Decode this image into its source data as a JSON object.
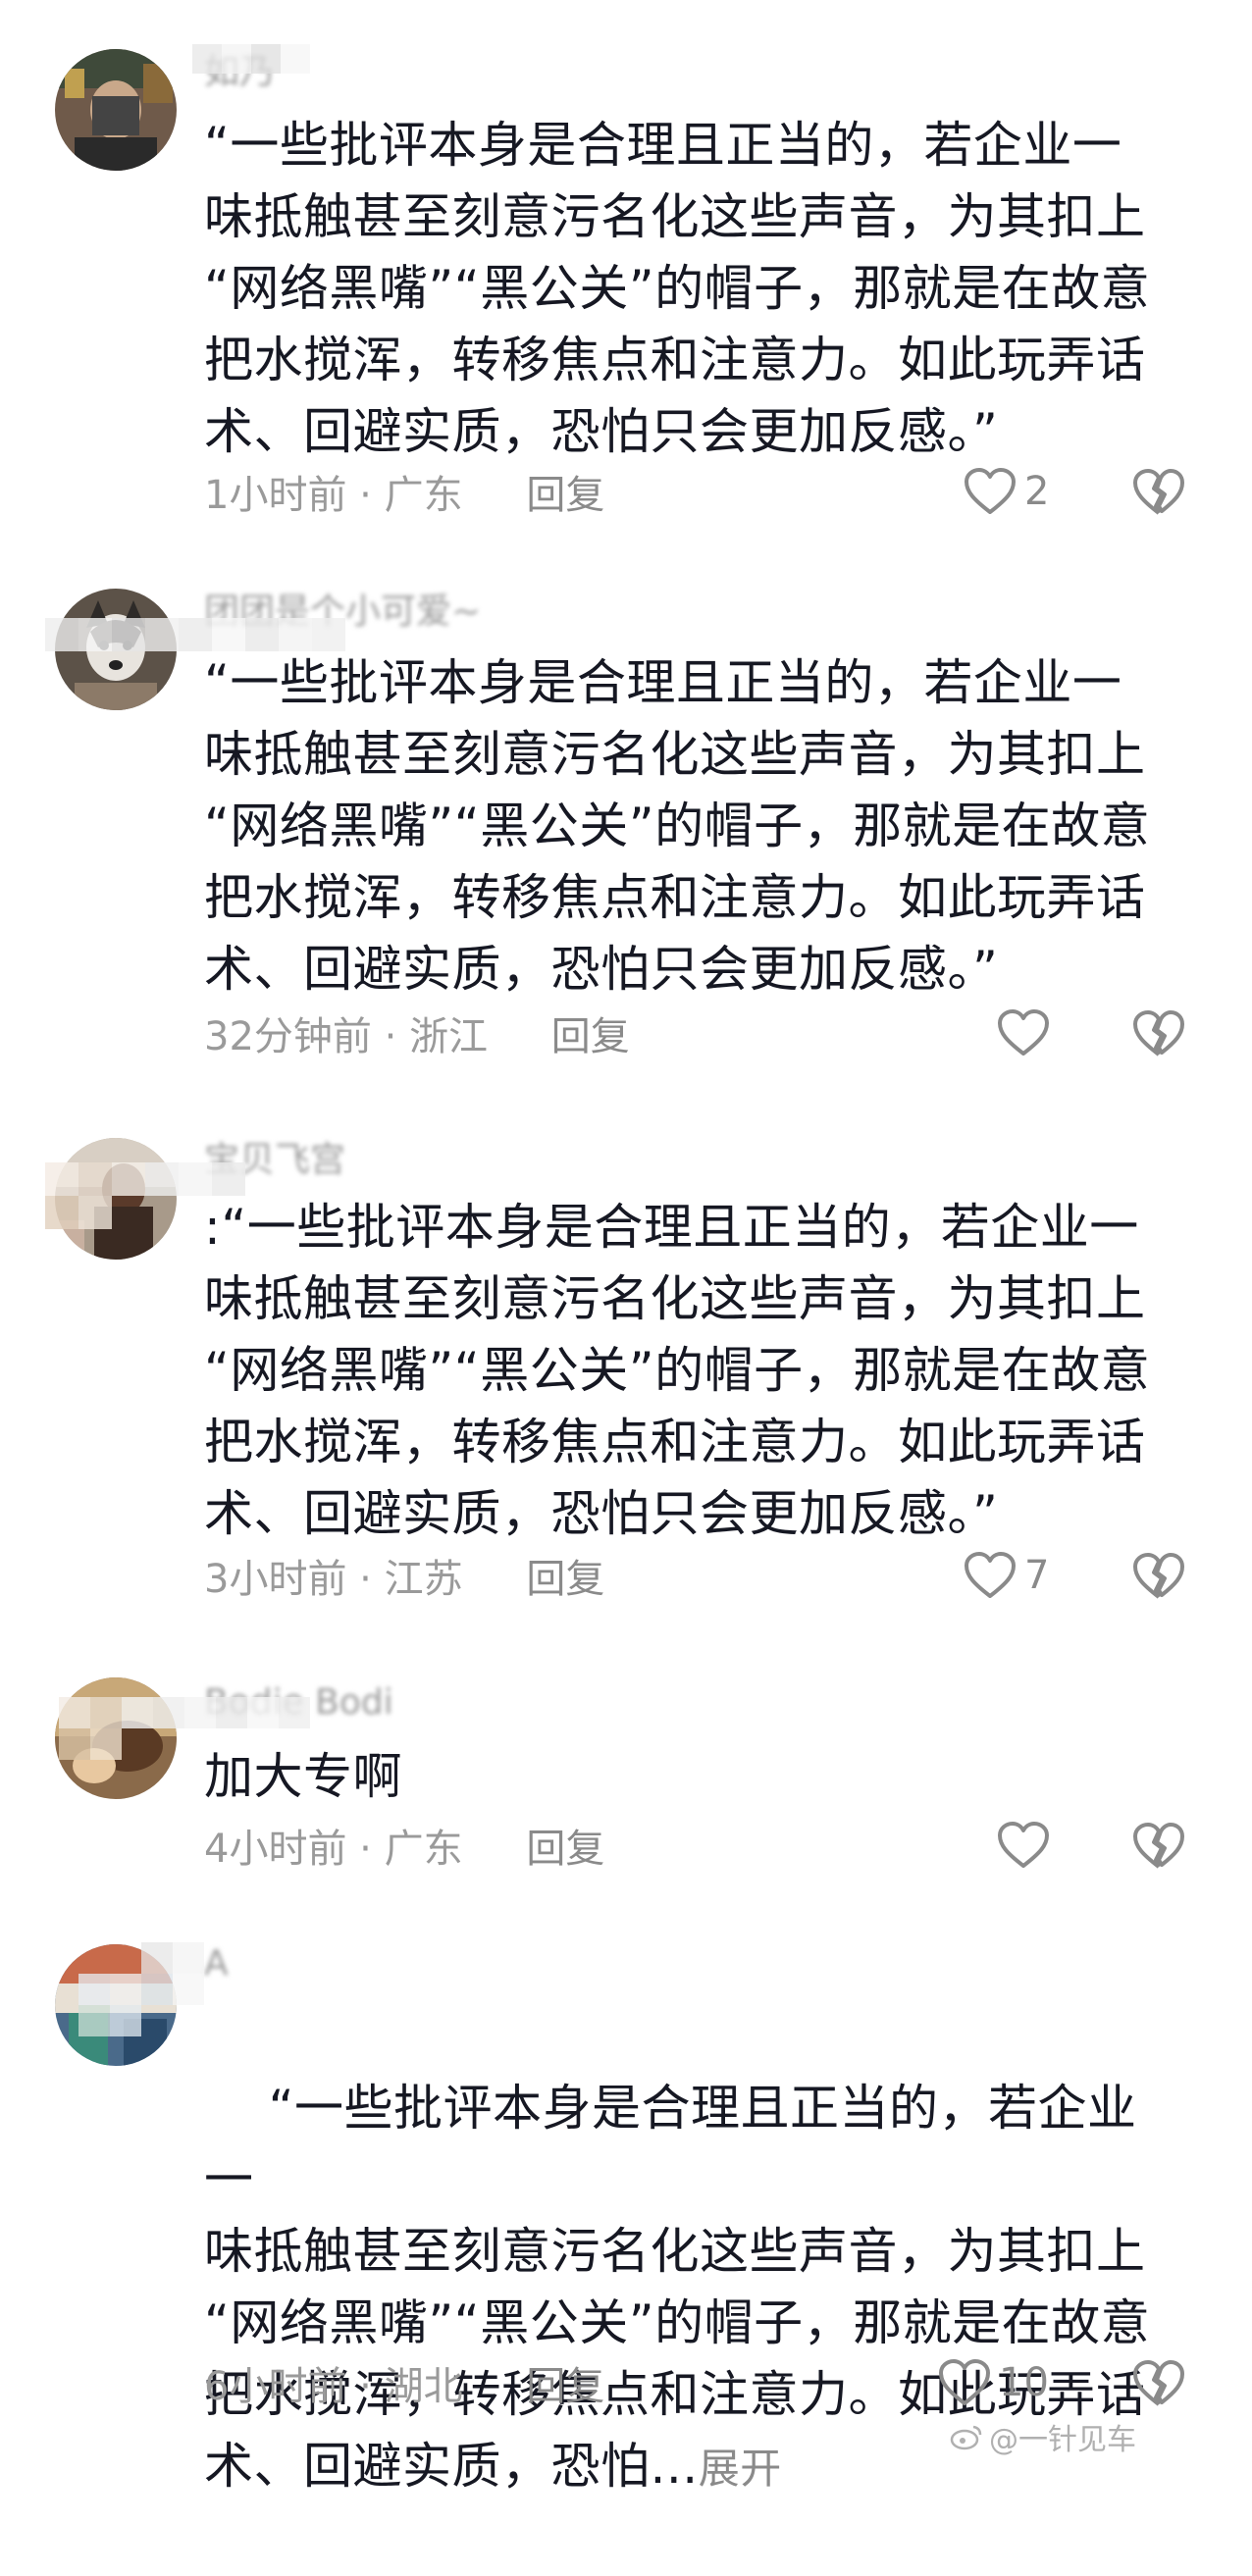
{
  "colors": {
    "text": "#161823",
    "meta": "#9a9a9a",
    "icon": "#8a8a8a",
    "background": "#ffffff"
  },
  "comments": [
    {
      "username": "如乃",
      "text": "“一些批评本身是合理且正当的，若企业一\n味抵触甚至刻意污名化这些声音，为其扣上\n“网络黑嘴”“黑公关”的帽子，那就是在故意\n把水搅浑，转移焦点和注意力。如此玩弄话\n术、回避实质，恐怕只会更加反感。”",
      "time": "1小时前",
      "sep": "·",
      "location": "广东",
      "reply_label": "回复",
      "likes": "2",
      "like_icon": "heart-icon",
      "dislike_icon": "broken-heart-icon"
    },
    {
      "username": "团团是个小可爱~",
      "text": "“一些批评本身是合理且正当的，若企业一\n味抵触甚至刻意污名化这些声音，为其扣上\n“网络黑嘴”“黑公关”的帽子，那就是在故意\n把水搅浑，转移焦点和注意力。如此玩弄话\n术、回避实质，恐怕只会更加反感。”",
      "time": "32分钟前",
      "sep": "·",
      "location": "浙江",
      "reply_label": "回复",
      "likes": "",
      "like_icon": "heart-icon",
      "dislike_icon": "broken-heart-icon"
    },
    {
      "username": "宝贝飞宫",
      "text": ":“一些批评本身是合理且正当的，若企业一\n味抵触甚至刻意污名化这些声音，为其扣上\n“网络黑嘴”“黑公关”的帽子，那就是在故意\n把水搅浑，转移焦点和注意力。如此玩弄话\n术、回避实质，恐怕只会更加反感。”",
      "time": "3小时前",
      "sep": "·",
      "location": "江苏",
      "reply_label": "回复",
      "likes": "7",
      "like_icon": "heart-icon",
      "dislike_icon": "broken-heart-icon"
    },
    {
      "username": "Bodie Bodi",
      "text": "加大专啊",
      "time": "4小时前",
      "sep": "·",
      "location": "广东",
      "reply_label": "回复",
      "likes": "",
      "like_icon": "heart-icon",
      "dislike_icon": "broken-heart-icon"
    },
    {
      "username": "A",
      "text": "“一些批评本身是合理且正当的，若企业一\n味抵触甚至刻意污名化这些声音，为其扣上\n“网络黑嘴”“黑公关”的帽子，那就是在故意\n把水搅浑，转移焦点和注意力。如此玩弄话\n术、回避实质，恐怕...",
      "expand_label": "展开",
      "time": "6小时前",
      "sep": "·",
      "location": "湖北",
      "reply_label": "回复",
      "likes": "10",
      "like_icon": "heart-icon",
      "dislike_icon": "broken-heart-icon"
    }
  ],
  "watermark": {
    "icon": "weibo-icon",
    "text": "@一针见车"
  }
}
